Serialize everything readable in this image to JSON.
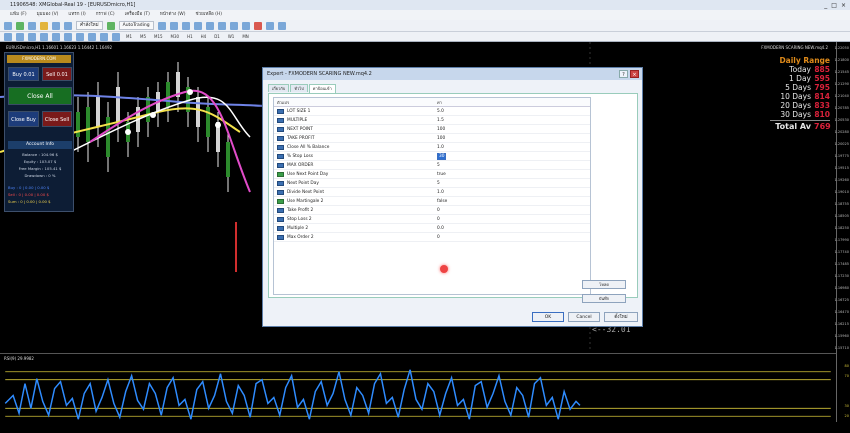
{
  "window": {
    "title": "11906548: XMGlobal-Real 19 - [EURUSDmicro,H1]",
    "controls": [
      "_",
      "□",
      "×"
    ]
  },
  "menubar": {
    "items": [
      "แฟ้ม (F)",
      "มุมมอง (V)",
      "แทรก (I)",
      "กราฟ (C)",
      "เครื่องมือ (T)",
      "หน้าต่าง (W)",
      "ช่วยเหลือ (H)"
    ]
  },
  "toolbar": {
    "new_order": "คำสั่งใหม่",
    "autotrading": "AutoTrading",
    "timeframes": [
      "M1",
      "M5",
      "M15",
      "M30",
      "H1",
      "H4",
      "D1",
      "W1",
      "MN"
    ]
  },
  "chart": {
    "symbol_label": "EURUSDmicro,H1  1.16601 1.16623 1.16442 1.16492",
    "ea_label": "FXMODERN SCARING NEW.mq4.2",
    "right_label": "<--32.01",
    "price_axis": [
      "1.22050",
      "1.21800",
      "1.21545",
      "1.21290",
      "1.21040",
      "1.20785",
      "1.20530",
      "1.20280",
      "1.20025",
      "1.19775",
      "1.19515",
      "1.19260",
      "1.19010",
      "1.18755",
      "1.18505",
      "1.18250",
      "1.17990",
      "1.17740",
      "1.17485",
      "1.17230",
      "1.16980",
      "1.16725",
      "1.16470",
      "1.16215",
      "1.15960",
      "1.15710"
    ],
    "rsi_label": "RSI(9) 29.9982",
    "rsi_axis": [
      "80",
      "70",
      "30",
      "20"
    ],
    "colors": {
      "ma_white": "#ffffff",
      "ma_yellow": "#f4e34c",
      "ma_blue": "#6f83e8",
      "ma_magenta": "#e14cc9",
      "rsi_line": "#2f8cff",
      "level_line": "#d2c238"
    }
  },
  "panel": {
    "brand": "FXMODERN.COM",
    "buy": "Buy 0.01",
    "sell": "Sell 0.01",
    "close_all": "Close All",
    "close_buy": "Close Buy",
    "close_sell": "Close Sell",
    "account_title": "Account Info",
    "balance": "Balance : 104.96 $",
    "equity": "Equity : 103.07 $",
    "free_margin": "Free Margin : 105.41 $",
    "drawdown": "Drawdown : 0 %",
    "buy_row": "Buy : 0 | 0.00 | 0.00 $",
    "sell_row": "Sell : 0 | 0.00 | 0.00 $",
    "sum_row": "Sum : 0 | 0.00 | 0.00 $"
  },
  "daily_range": {
    "title": "Daily Range",
    "rows": [
      {
        "label": "Today",
        "value": "885"
      },
      {
        "label": "1 Day",
        "value": "595"
      },
      {
        "label": "5 Days",
        "value": "795"
      },
      {
        "label": "10 Days",
        "value": "814"
      },
      {
        "label": "20 Days",
        "value": "833"
      },
      {
        "label": "30 Days",
        "value": "810"
      }
    ],
    "total_label": "Total Av",
    "total_value": "769"
  },
  "dialog": {
    "title": "Expert - FXMODERN SCARING NEW.mq4.2",
    "tabs": [
      "เกี่ยวกับ",
      "ทั่วไป",
      "ค่าป้อนเข้า"
    ],
    "col_variable": "ตัวแปร",
    "col_value": "ค่า",
    "params": [
      {
        "name": "LOT SIZE 1",
        "value": "5.0"
      },
      {
        "name": "MULTIPLE",
        "value": "1.5"
      },
      {
        "name": "NEXT POINT",
        "value": "100"
      },
      {
        "name": "TAKE PROFIT",
        "value": "100"
      },
      {
        "name": "Close All % Balance",
        "value": "1.0"
      },
      {
        "name": "% Stop Loss",
        "value": "30"
      },
      {
        "name": "MAX ORDER",
        "value": "5"
      },
      {
        "name": "Use Next Point Day",
        "value": "true"
      },
      {
        "name": "Next Point Day",
        "value": "5"
      },
      {
        "name": "Divide Next Point",
        "value": "1.0"
      },
      {
        "name": "Use Martingale 2",
        "value": "false"
      },
      {
        "name": "Take Profit 2",
        "value": "0"
      },
      {
        "name": "Stop Loss 2",
        "value": "0"
      },
      {
        "name": "Multiple 2",
        "value": "0.0"
      },
      {
        "name": "Max Order 2",
        "value": "0"
      }
    ],
    "load_label": "โหลด",
    "save_label": "บันทึก",
    "ok_label": "OK",
    "cancel_label": "Cancel",
    "reset_label": "ตั้งใหม่"
  }
}
